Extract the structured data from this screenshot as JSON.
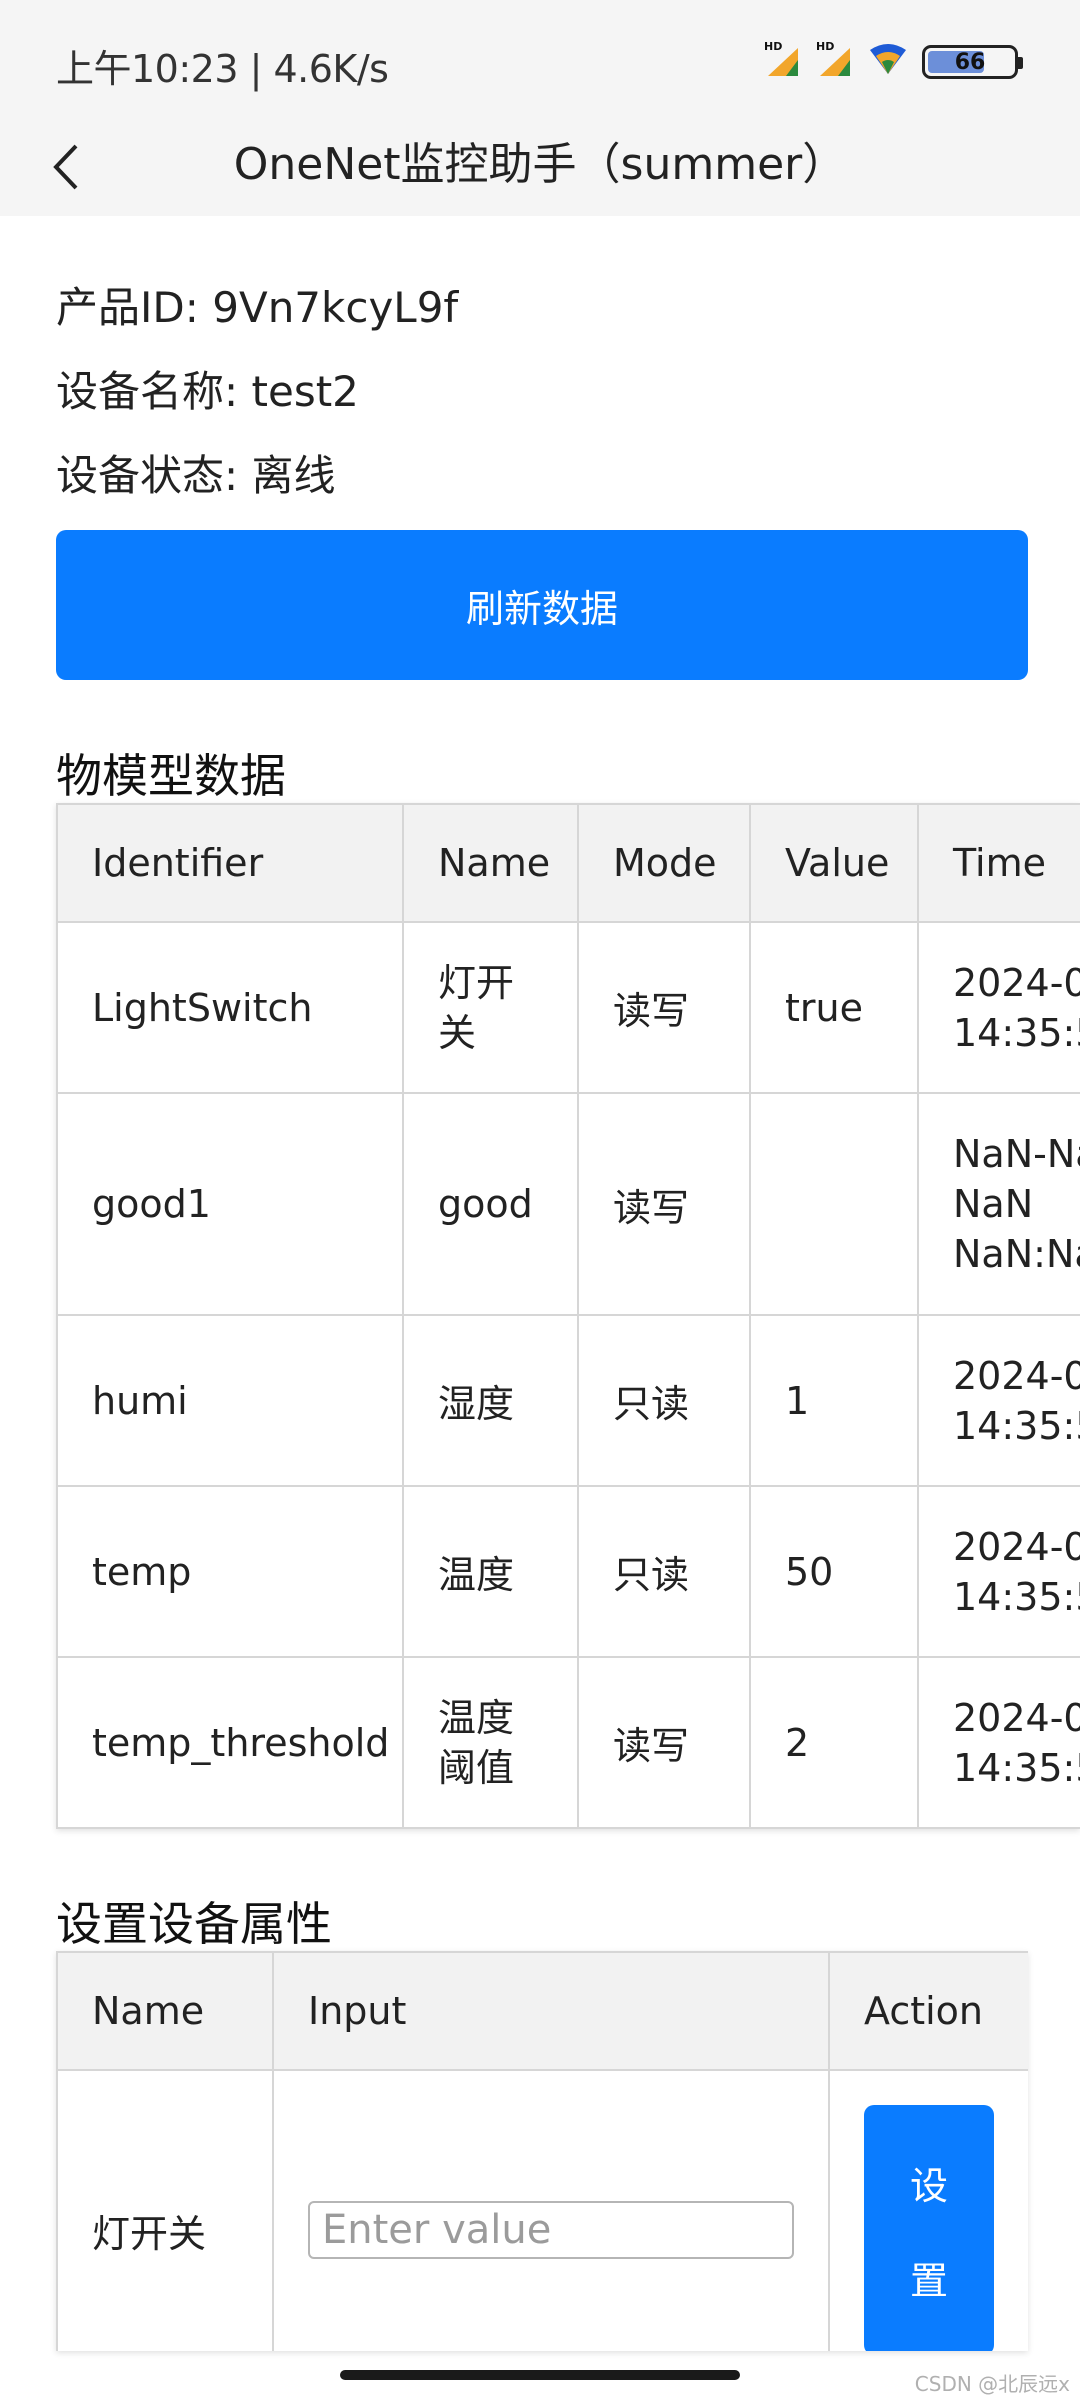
{
  "status_bar": {
    "time_speed": "上午10:23 | 4.6K/s",
    "battery_level": "66",
    "signal_badge": "HD"
  },
  "header": {
    "title": "OneNet监控助手（summer）"
  },
  "device_info": {
    "product_id_label": "产品ID: ",
    "product_id": "9Vn7kcyL9f",
    "device_name_label": "设备名称: ",
    "device_name": "test2",
    "device_status_label": "设备状态: ",
    "device_status": "离线"
  },
  "refresh_button": {
    "label": "刷新数据"
  },
  "model_section": {
    "title": "物模型数据",
    "columns": [
      "Identifier",
      "Name",
      "Mode",
      "Value",
      "Time"
    ],
    "rows": [
      {
        "identifier": "LightSwitch",
        "name": "灯开关",
        "mode": "读写",
        "value": "true",
        "time_line1": "2024-0",
        "time_line2": "14:35:5",
        "time_line3": ""
      },
      {
        "identifier": "good1",
        "name": "good",
        "mode": "读写",
        "value": "",
        "time_line1": "NaN-Na",
        "time_line2": "NaN",
        "time_line3": "NaN:Na"
      },
      {
        "identifier": "humi",
        "name": "湿度",
        "mode": "只读",
        "value": "1",
        "time_line1": "2024-0",
        "time_line2": "14:35:5",
        "time_line3": ""
      },
      {
        "identifier": "temp",
        "name": "温度",
        "mode": "只读",
        "value": "50",
        "time_line1": "2024-0",
        "time_line2": "14:35:5",
        "time_line3": ""
      },
      {
        "identifier": "temp_threshold",
        "name": "温度阈值",
        "mode": "读写",
        "value": "2",
        "time_line1": "2024-0",
        "time_line2": "14:35:5",
        "time_line3": ""
      }
    ]
  },
  "set_section": {
    "title": "设置设备属性",
    "columns": [
      "Name",
      "Input",
      "Action"
    ],
    "rows": [
      {
        "name": "灯开关",
        "input_placeholder": "Enter value",
        "button_char1": "设",
        "button_char2": "置"
      }
    ]
  },
  "watermark": "CSDN @北辰远x"
}
